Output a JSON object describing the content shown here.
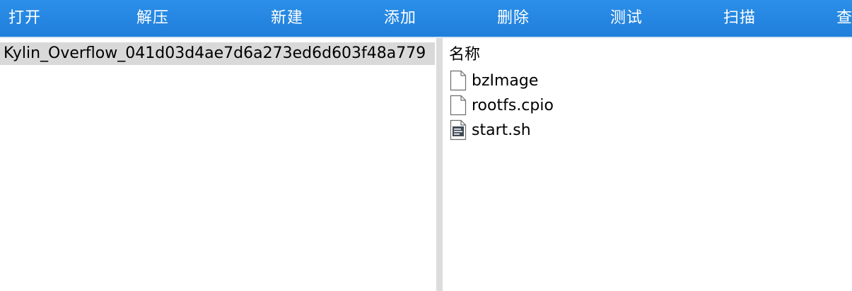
{
  "toolbar": {
    "buttons": [
      {
        "label": "打开"
      },
      {
        "label": "解压"
      },
      {
        "label": "新建"
      },
      {
        "label": "添加"
      },
      {
        "label": "删除"
      },
      {
        "label": "测试"
      },
      {
        "label": "扫描"
      },
      {
        "label": "查"
      }
    ]
  },
  "tree": {
    "selected_item": "Kylin_Overflow_041d03d4ae7d6a273ed6d603f48a779"
  },
  "file_list": {
    "column_name": "名称",
    "files": [
      {
        "name": "bzImage",
        "icon": "file-icon"
      },
      {
        "name": "rootfs.cpio",
        "icon": "file-icon"
      },
      {
        "name": "start.sh",
        "icon": "script-file-icon"
      }
    ]
  },
  "colors": {
    "toolbar_bg": "#1f7fdb",
    "selected_row": "#d9d9d9",
    "splitter": "#dcdcdc"
  }
}
